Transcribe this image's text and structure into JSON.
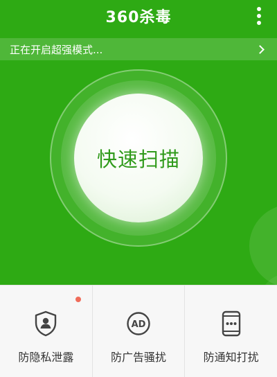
{
  "app": {
    "title": "360杀毒",
    "menu_icon": "more-vertical-icon",
    "theme_color": "#2eaa14"
  },
  "banner": {
    "text": "正在开启超强模式...",
    "arrow_icon": "chevron-right-icon"
  },
  "scan": {
    "label": "快速扫描"
  },
  "tools": [
    {
      "label": "防隐私泄露",
      "icon": "shield-user-icon",
      "has_notification": true,
      "notification_color": "#f06c5a"
    },
    {
      "label": "防广告骚扰",
      "icon": "ad-block-icon",
      "has_notification": false
    },
    {
      "label": "防通知打扰",
      "icon": "phone-notification-icon",
      "has_notification": false
    }
  ]
}
